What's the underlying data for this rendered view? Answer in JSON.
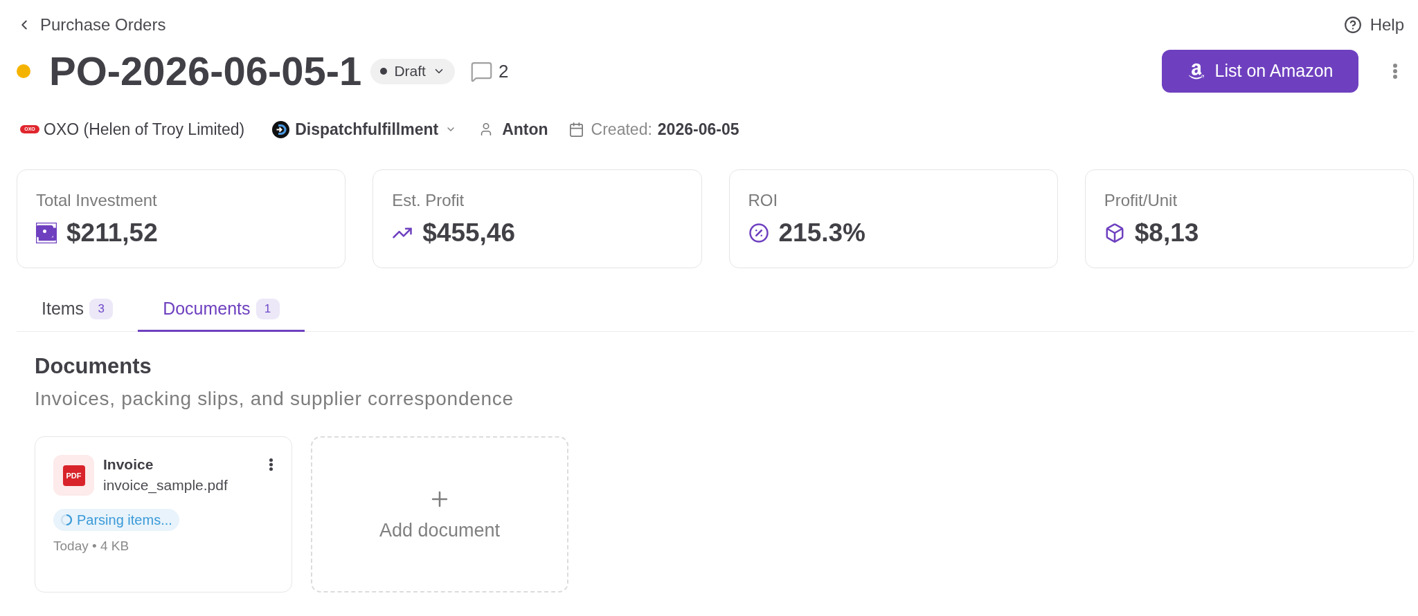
{
  "nav": {
    "back_label": "Purchase Orders",
    "help_label": "Help"
  },
  "header": {
    "status_dot": {
      "color": "#f5b301"
    },
    "title": "PO-2026-06-05-1",
    "status": "Draft",
    "comment_count": "2",
    "primary_action": "List on Amazon"
  },
  "meta": {
    "supplier_logo": "OXO",
    "supplier": "OXO (Helen of Troy Limited)",
    "fulfillment": "Dispatchfulfillment",
    "owner": "Anton",
    "created_label": "Created:",
    "created_date": "2026-06-05"
  },
  "stats": [
    {
      "label": "Total Investment",
      "value": "$211,52"
    },
    {
      "label": "Est. Profit",
      "value": "$455,46"
    },
    {
      "label": "ROI",
      "value": "215.3%"
    },
    {
      "label": "Profit/Unit",
      "value": "$8,13"
    }
  ],
  "tabs": [
    {
      "label": "Items",
      "count": "3",
      "selected": false
    },
    {
      "label": "Documents",
      "count": "1",
      "selected": true
    }
  ],
  "documents": {
    "title": "Documents",
    "subtitle": "Invoices, packing slips, and supplier correspondence",
    "files": [
      {
        "file_type": "PDF",
        "name": "Invoice",
        "filename": "invoice_sample.pdf",
        "status": "Parsing items...",
        "details": "Today • 4 KB"
      }
    ],
    "add_label": "Add document"
  }
}
